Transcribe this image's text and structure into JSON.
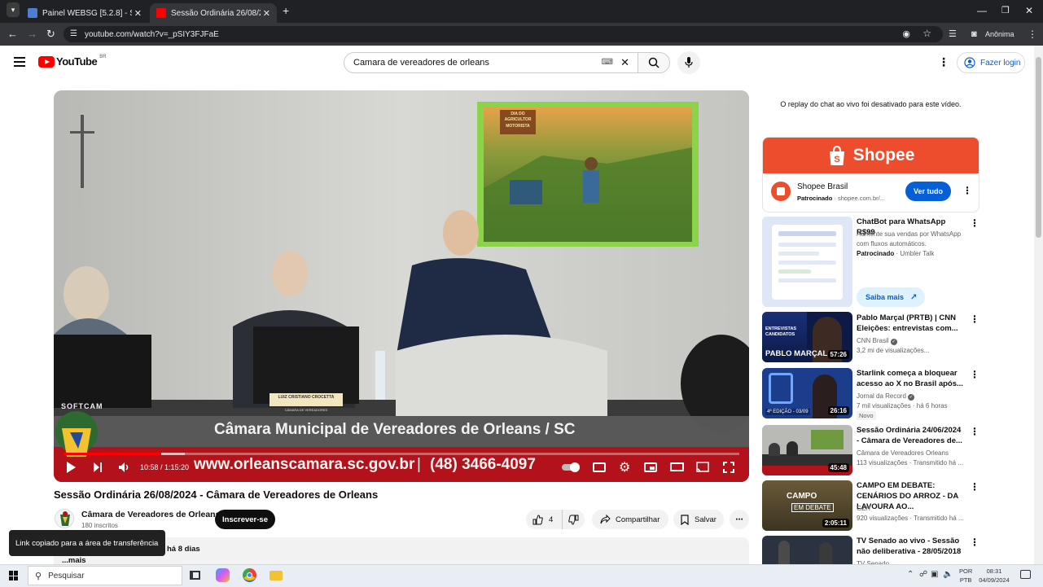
{
  "browser": {
    "tabs": [
      {
        "title": "Painel WEBSG [5.2.8] - Sistema",
        "active": false
      },
      {
        "title": "Sessão Ordinária 26/08/2024 -",
        "active": true
      }
    ],
    "url": "youtube.com/watch?v=_pSIY3FJFaE",
    "profile_label": "Anônima"
  },
  "header": {
    "logo_text": "YouTube",
    "logo_region": "BR",
    "search_value": "Camara de vereadores de orleans",
    "login_label": "Fazer login"
  },
  "video": {
    "overlay_softcam": "SOFTCAM",
    "banner_title": "Câmara Municipal de Vereadores de Orleans / SC",
    "banner_url": "www.orleanscamara.sc.gov.br",
    "banner_phone": "(48) 3466-4097",
    "nameplate": "LUIZ CRISTIANO CROCETTA",
    "nameplate_sub": "CÂMARA DE VEREADORES",
    "screen_text_1": "DIA DO",
    "screen_text_2": "AGRICULTOR",
    "screen_text_3": "MOTORISTA",
    "time": "10:58 / 1:15:20",
    "progress": 0.145,
    "title": "Sessão Ordinária 26/08/2024 - Câmara de Vereadores de Orleans"
  },
  "channel": {
    "name": "Câmara de Vereadores de Orleans",
    "subs": "180 inscritos",
    "subscribe_label": "Inscrever-se",
    "likes": "4",
    "share_label": "Compartilhar",
    "save_label": "Salvar"
  },
  "description": {
    "age": "há 8 dias",
    "more_label": "...mais"
  },
  "toast": "Link copiado para a área de transferência",
  "sidebar": {
    "chat_notice": "O replay do chat ao vivo foi desativado para este vídeo.",
    "ad": {
      "brand_banner": "Shopee",
      "name": "Shopee Brasil",
      "sponsored": "Patrocinado",
      "domain": "shopee.com.br/...",
      "cta": "Ver tudo"
    },
    "ad2": {
      "title": "ChatBot para WhatsApp R$99",
      "desc": "Aumente sua vendas por WhatsApp com fluxos automáticos.",
      "sponsored": "Patrocinado",
      "advertiser": "Umbler Talk",
      "cta": "Saiba mais"
    },
    "videos": [
      {
        "title": "Pablo Marçal (PRTB) | CNN Eleições: entrevistas com...",
        "channel": "CNN Brasil",
        "meta": "3,2 mi de visualizações...",
        "duration": "57:26",
        "badge": ""
      },
      {
        "title": "Starlink começa a bloquear acesso ao X no Brasil após...",
        "channel": "Jornal da Record",
        "meta": "7 mil visualizações · há 6 horas",
        "duration": "26:16",
        "badge": "Novo"
      },
      {
        "title": "Sessão Ordinária 24/06/2024 - Câmara de Vereadores de...",
        "channel": "Câmara de Vereadores Orleans",
        "meta": "113 visualizações · Transmitido há ...",
        "duration": "45:48",
        "badge": ""
      },
      {
        "title": "CAMPO EM DEBATE: CENÁRIOS DO ARROZ - DA LAVOURA AO...",
        "channel": "GZH",
        "meta": "920 visualizações · Transmitido há ...",
        "duration": "2:05:11",
        "badge": ""
      },
      {
        "title": "TV Senado ao vivo - Sessão não deliberativa - 28/05/2018",
        "channel": "TV Senado",
        "meta": "",
        "duration": "",
        "badge": ""
      }
    ],
    "thumb_texts": {
      "cnn_label": "ENTREVISTAS CANDIDATOS",
      "cnn_name": "PABLO MARÇAL",
      "record_label": "4ª EDIÇÃO - 03/09",
      "campo_label_1": "CAMPO",
      "campo_label_2": "EM DEBATE"
    }
  },
  "taskbar": {
    "search_placeholder": "Pesquisar",
    "lang": "POR",
    "lang_sub": "PTB",
    "time": "08:31",
    "date": "04/09/2024"
  },
  "colors": {
    "yt_red": "#ff0000",
    "shopee_orange": "#ee4d2d",
    "link_blue": "#065fd4",
    "banner_red": "#b3121a"
  }
}
